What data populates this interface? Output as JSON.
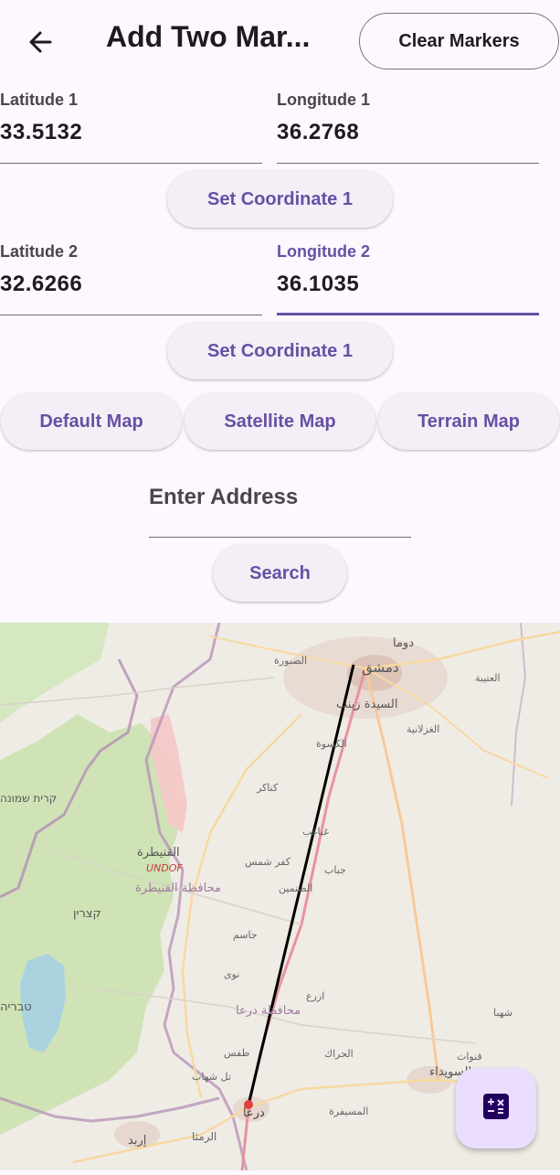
{
  "appbar": {
    "title": "Add Two Mar...",
    "clear_label": "Clear Markers"
  },
  "coord1": {
    "lat_label": "Latitude 1",
    "lat_value": "33.5132",
    "lng_label": "Longitude 1",
    "lng_value": "36.2768",
    "button": "Set Coordinate 1"
  },
  "coord2": {
    "lat_label": "Latitude 2",
    "lat_value": "32.6266",
    "lng_label": "Longitude 2",
    "lng_value": "36.1035",
    "button": "Set Coordinate 1"
  },
  "map_types": {
    "default": "Default Map",
    "satellite": "Satellite Map",
    "terrain": "Terrain Map"
  },
  "address": {
    "placeholder": "Enter Address",
    "search": "Search"
  },
  "map": {
    "labels": {
      "damascus": "دمشق",
      "douma": "دوما",
      "sayyida": "السيدة زينب",
      "quneitra": "القنيطرة",
      "undof": "UNDOF",
      "quneitra_gov": "محافظة القنيطرة",
      "kiswah": "الكسوة",
      "daraa_gov": "محافظة درعا",
      "daraa": "درعا",
      "suwayda": "السويداء",
      "shahba": "شهبا",
      "izraa": "ازرع",
      "sanamayn": "الصنمين",
      "kanaker": "كناكر",
      "ghabagheb": "غباغب",
      "kafr_shams": "كفر شمس",
      "nawa": "نوى",
      "tafas": "طفس",
      "busra": "بصرى",
      "irbid": "إربد",
      "ramtha": "الرمثا",
      "tiberias": "טבריה",
      "katzrin": "קצרין",
      "kiryat_shmona": "קרית שמונה",
      "muhardeh": "المسيفرة",
      "hrak": "الحراك",
      "jabab": "جباب",
      "otaybah": "العتيبة",
      "qunawat": "قنوات",
      "jasim": "جاسم",
      "mismiyah": "المسمية",
      "sabura": "الصبورة",
      "ghizlaniyah": "الغزلانية",
      "tel_shihab": "تل شهاب",
      "sheikh_miskin": "الشيخ مسكين"
    }
  },
  "fab": {
    "icon": "calculator-icon"
  }
}
